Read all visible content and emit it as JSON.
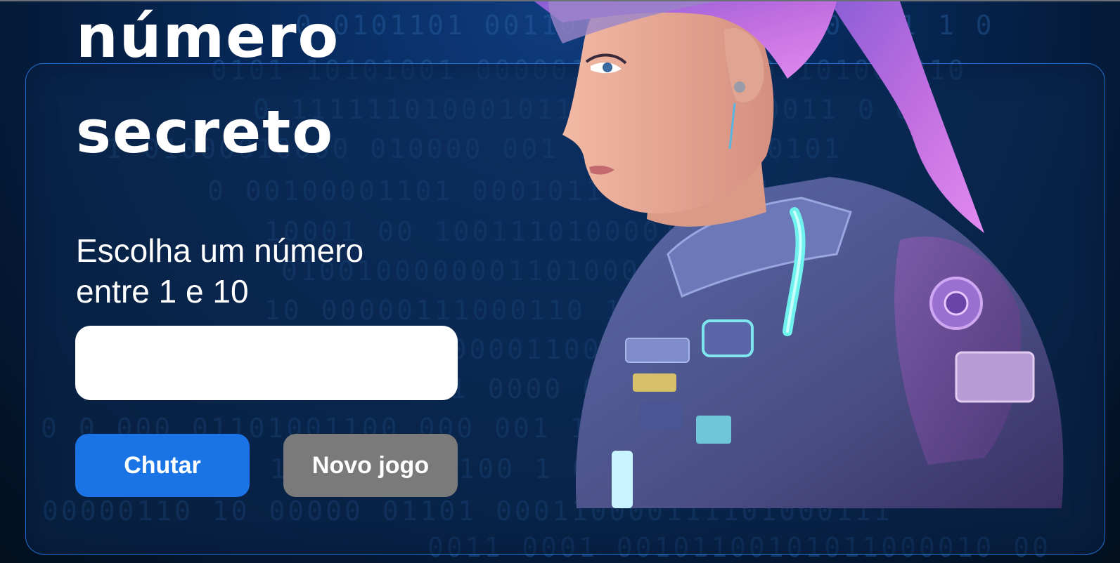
{
  "title": {
    "line1": "número",
    "line2": "secreto"
  },
  "game": {
    "prompt_line1": "Escolha um número",
    "prompt_line2": "entre 1 e 10",
    "guess_value": "",
    "guess_label": "Chutar",
    "new_game_label": "Novo jogo"
  },
  "background": {
    "binary_rows": [
      "0 0101101 0011010 1 1011011 0 1 1 1 0",
      "0101 10101001 000001100100 1 01101000010",
      "0 11111101000101100 0001 100011 0 0",
      "1 01000010000 010000 001 1 0101 1 00101",
      "0 00100001101 0001011 011 10 1",
      "10001 00 1001110100001010 0 1 1101",
      "01001000000011010000 0 0011 0 0100",
      "10 00000111000110 100 1 110",
      "0 1000011001011100001 01 0",
      "1 0000 0 1 0 0001101 01 0",
      "0 0 000 01101001100 000 001 1",
      "1 1 010 0000100 1 0 0 1",
      "00000110 10 00000 01101 000110000111101000111",
      "0011 0001 00101100101011000010 00"
    ]
  },
  "colors": {
    "background": "#072a5c",
    "card_border": "#1f6fd0",
    "guess_button": "#1a74e6",
    "new_game_button": "#7a7a7a",
    "text": "#ffffff"
  }
}
